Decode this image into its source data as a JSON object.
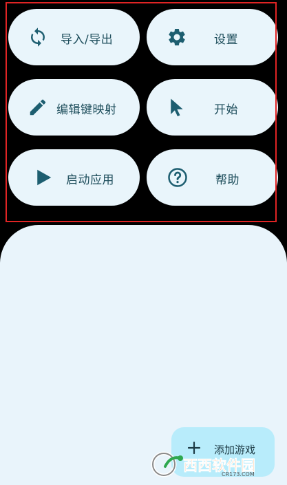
{
  "grid": {
    "items": [
      {
        "label": "导入/导出",
        "icon": "sync-icon"
      },
      {
        "label": "设置",
        "icon": "gear-icon"
      },
      {
        "label": "编辑键映射",
        "icon": "pencil-icon"
      },
      {
        "label": "开始",
        "icon": "cursor-icon"
      },
      {
        "label": "启动应用",
        "icon": "play-icon"
      },
      {
        "label": "帮助",
        "icon": "help-icon"
      }
    ]
  },
  "fab": {
    "label": "添加游戏",
    "icon": "plus-icon"
  },
  "watermark": {
    "brand": "西西软件园",
    "url": "CR173.COM"
  },
  "colors": {
    "background": "#000000",
    "pill": "#e9f5fb",
    "icon": "#1d5e70",
    "text": "#1d4d5b",
    "highlight": "#e02424",
    "fab": "#b8ecfb"
  }
}
